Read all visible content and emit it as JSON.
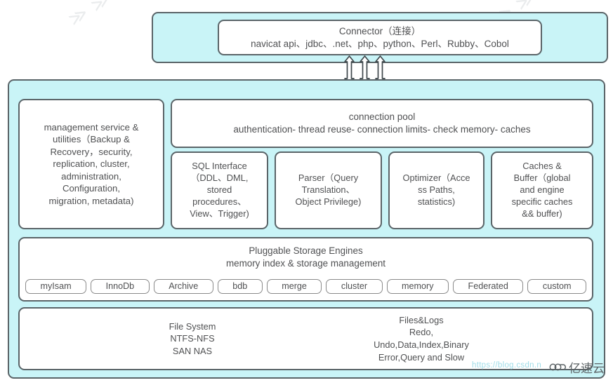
{
  "diagram": {
    "title": "MySQL Architecture Diagram",
    "colors": {
      "layer_fill": "#c9f4f7",
      "box_fill": "#ffffff",
      "border": "#5a6468",
      "chip_border": "#8a8a8a",
      "text": "#4f5052"
    }
  },
  "connector": {
    "band_name": "connector-layer",
    "title": "Connector（连接）",
    "subtitle": "navicat api、jdbc、.net、php、python、Perl、Rubby、Cobol"
  },
  "arrows": {
    "name": "bidirectional-arrows",
    "count": 3,
    "direction": "up-down"
  },
  "server": {
    "management": {
      "label": "management service &\nutilities（Backup &\nRecovery，security,\nreplication, cluster,\nadministration,\nConfiguration,\nmigration, metadata)"
    },
    "connection_pool": {
      "title": "connection pool",
      "subtitle": "authentication- thread reuse- connection limits- check memory- caches"
    },
    "modules": [
      {
        "name": "sql-interface",
        "label": "SQL Interface\n（DDL、DML,\nstored\nprocedures、\nView、Trigger)"
      },
      {
        "name": "parser",
        "label": "Parser（Query\nTranslation、\nObject Privilege)"
      },
      {
        "name": "optimizer",
        "label": "Optimizer（Acce\nss Paths,\nstatistics)"
      },
      {
        "name": "caches-buffer",
        "label": "Caches &\nBuffer（global\nand engine\nspecific caches\n&& buffer)"
      }
    ],
    "storage_engines": {
      "title": "Pluggable Storage Engines\nmemory index & storage management",
      "engines": [
        "myIsam",
        "InnoDb",
        "Archive",
        "bdb",
        "merge",
        "cluster",
        "memory",
        "Federated",
        "custom"
      ]
    },
    "file_system": {
      "left": "File System\nNTFS-NFS\nSAN NAS",
      "right": "Files&Logs\nRedo,\nUndo,Data,Index,Binary\nError,Query and Slow"
    }
  },
  "watermarks": {
    "diagonal": "≫ ≫",
    "url": "https://blog.csdn.n",
    "logo_text": "亿速云"
  }
}
